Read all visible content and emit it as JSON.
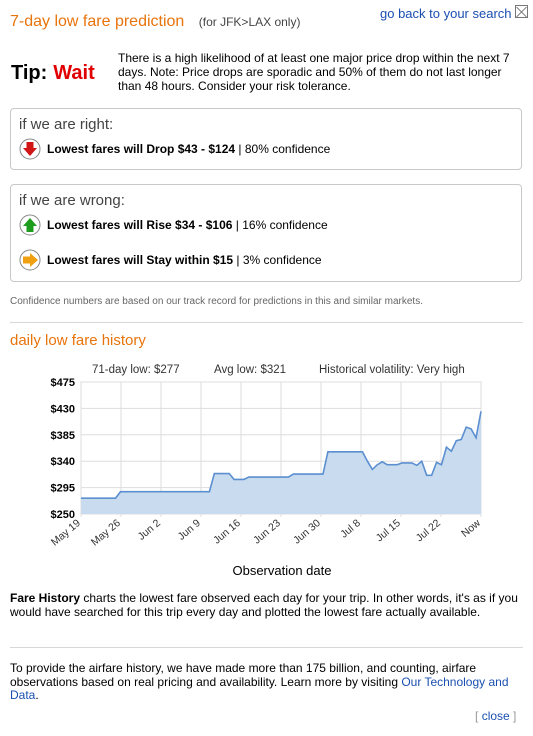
{
  "header": {
    "title": "7-day low fare prediction",
    "subtitle": "(for JFK>LAX only)",
    "back_link": "go back to your search"
  },
  "tip": {
    "label": "Tip:",
    "value": "Wait",
    "text": "There is a high likelihood of at least one major price drop within the next 7 days. Note: Price drops are sporadic and 50% of them do not last longer than 48 hours. Consider your risk tolerance."
  },
  "right_box": {
    "heading": "if we are right:",
    "items": [
      {
        "bold": "Lowest fares will Drop $43 - $124",
        "rest": " | 80% confidence",
        "icon": "down-arrow-red-icon"
      }
    ]
  },
  "wrong_box": {
    "heading": "if we are wrong:",
    "items": [
      {
        "bold": "Lowest fares will Rise $34 - $106",
        "rest": " | 16% confidence",
        "icon": "up-arrow-green-icon"
      },
      {
        "bold": "Lowest fares will Stay within $15",
        "rest": " | 3% confidence",
        "icon": "right-arrow-orange-icon"
      }
    ]
  },
  "confidence_note": "Confidence numbers are based on our track record for predictions in this and similar markets.",
  "history": {
    "heading": "daily low fare history",
    "low": "71-day low: $277",
    "avg": "Avg low: $321",
    "volatility": "Historical volatility: Very high"
  },
  "chart_data": {
    "type": "area",
    "xlabel": "Observation date",
    "ylabel": "",
    "ylim": [
      250,
      475
    ],
    "yticks": [
      "$475",
      "$430",
      "$385",
      "$340",
      "$295",
      "$250"
    ],
    "ytick_values": [
      475,
      430,
      385,
      340,
      295,
      250
    ],
    "xticks": [
      "May 19",
      "May 26",
      "Jun 2",
      "Jun 9",
      "Jun 16",
      "Jun 23",
      "Jun 30",
      "Jul 8",
      "Jul 15",
      "Jul 22",
      "Now"
    ],
    "grid": true,
    "colors": {
      "line": "#5b8fd0",
      "fill": "#c9dbee",
      "grid": "#dddddd"
    },
    "series": [
      {
        "values": [
          277,
          277,
          277,
          277,
          277,
          277,
          277,
          277,
          288,
          288,
          288,
          288,
          288,
          288,
          288,
          288,
          288,
          288,
          288,
          288,
          288,
          288,
          288,
          288,
          288,
          288,
          288,
          319,
          319,
          319,
          319,
          309,
          309,
          309,
          313,
          313,
          313,
          313,
          313,
          313,
          313,
          313,
          313,
          318,
          318,
          318,
          318,
          318,
          318,
          318,
          356,
          356,
          356,
          356,
          356,
          356,
          356,
          356,
          340,
          326,
          334,
          339,
          334,
          334,
          334,
          337,
          337,
          337,
          333,
          340,
          316,
          316,
          338,
          334,
          364,
          357,
          375,
          377,
          398,
          395,
          380,
          425
        ]
      }
    ]
  },
  "fare_history_text": {
    "bold": "Fare History",
    "rest": " charts the lowest fare observed each day for your trip. In other words, it's as if you would have searched for this trip every day and plotted the lowest fare actually available."
  },
  "footer": {
    "text": "To provide the airfare history, we have made more than 175 billion, and counting, airfare observations based on real pricing and availability. Learn more by visiting ",
    "link": "Our Technology and Data",
    "end": "."
  },
  "close_link": {
    "open": "[",
    "label": "close",
    "end": "]"
  }
}
